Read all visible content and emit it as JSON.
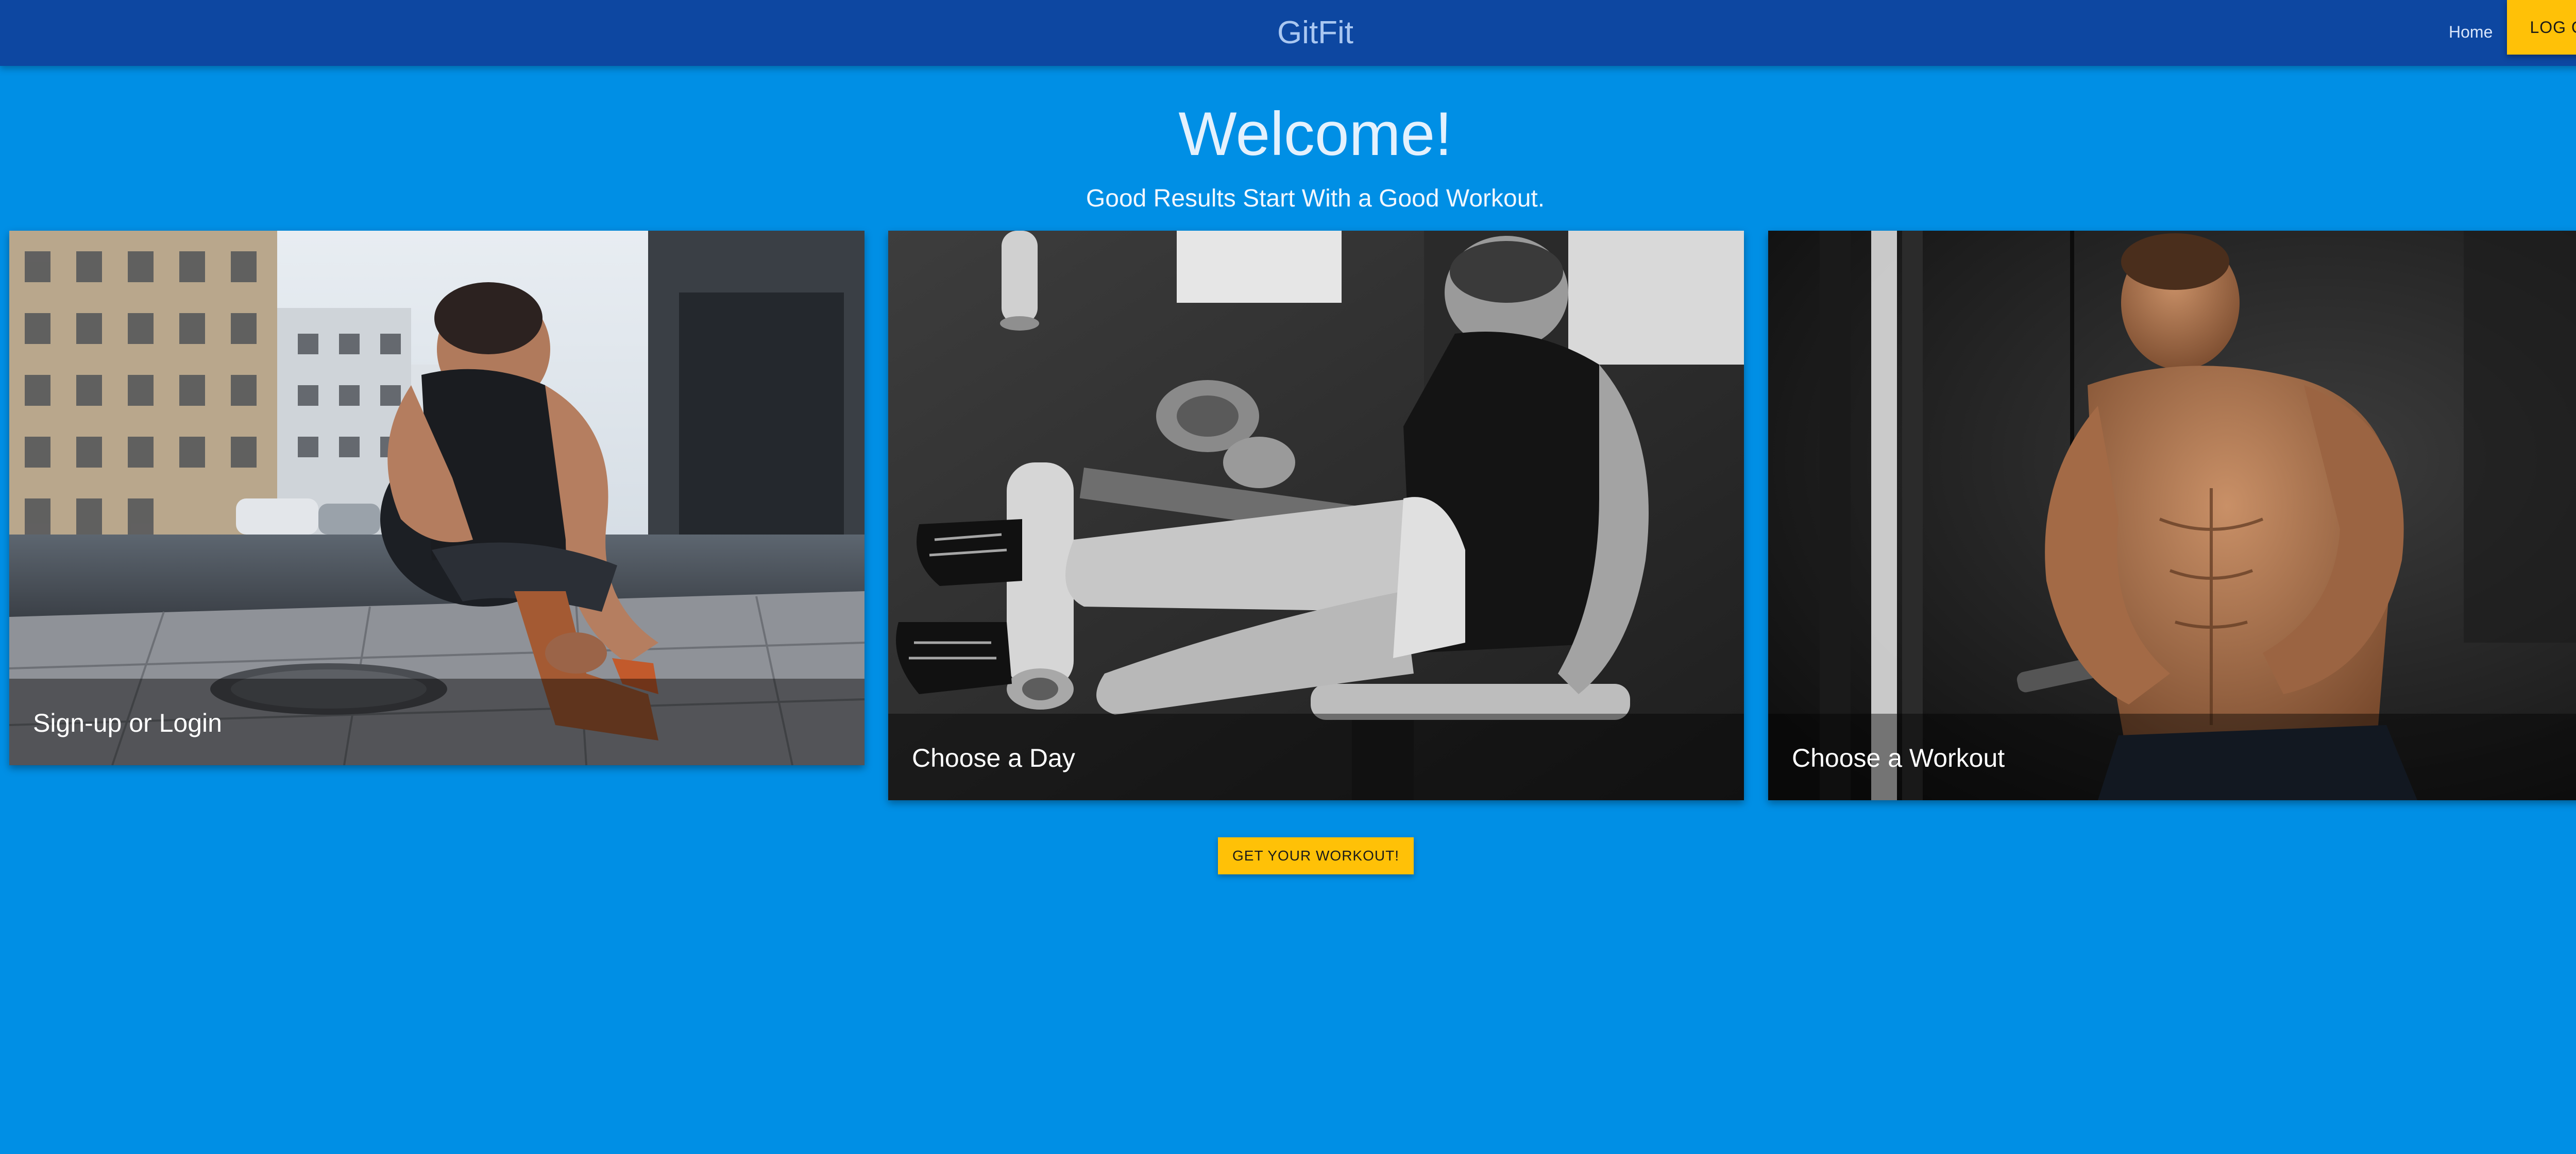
{
  "app": {
    "brand": "GitFit"
  },
  "nav": {
    "home_label": "Home",
    "logout_label": "LOG OUT"
  },
  "hero": {
    "title": "Welcome!",
    "subtitle": "Good Results Start With a Good Workout."
  },
  "cards": [
    {
      "caption": "Sign-up or Login",
      "image": "runner-tying-shoe-photo"
    },
    {
      "caption": "Choose a Day",
      "image": "leg-extension-machine-photo"
    },
    {
      "caption": "Choose a Workout",
      "image": "cable-curl-photo"
    }
  ],
  "cta": {
    "label": "GET YOUR WORKOUT!"
  },
  "colors": {
    "page_background": "#008fe5",
    "navbar": "#0d47a1",
    "accent_button": "#ffc107"
  }
}
